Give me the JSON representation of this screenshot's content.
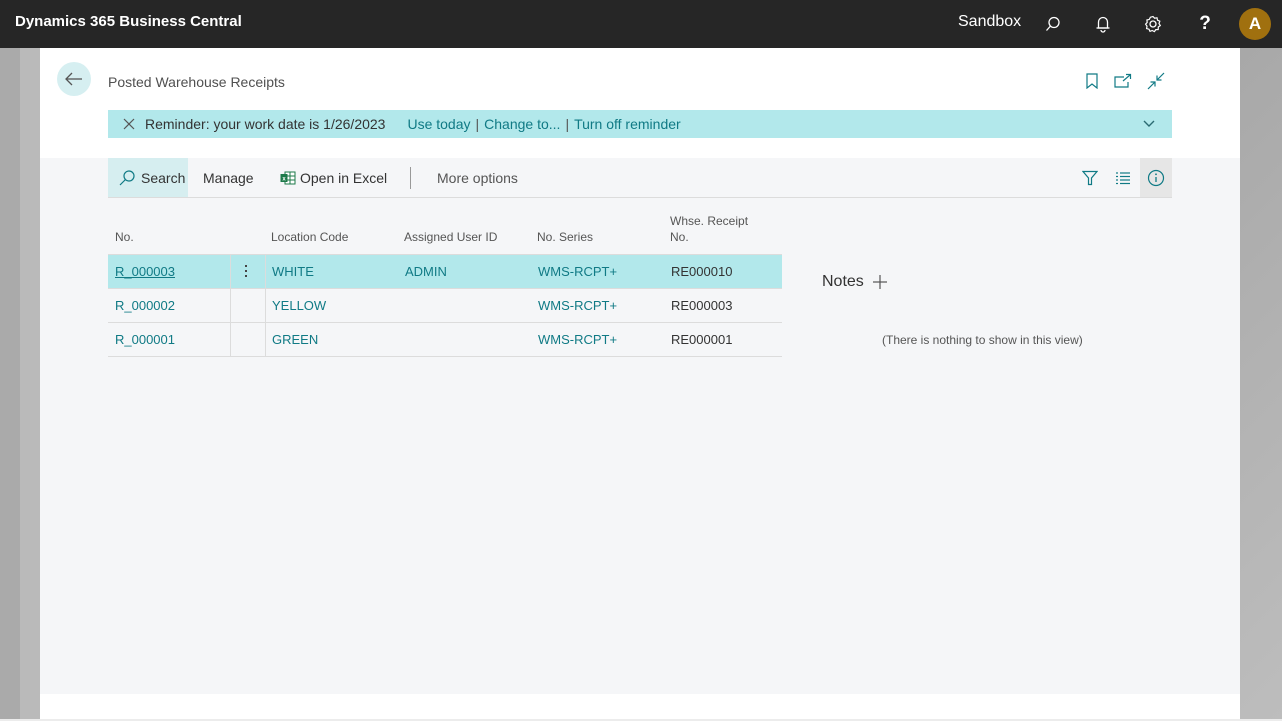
{
  "topbar": {
    "app_title": "Dynamics 365 Business Central",
    "environment": "Sandbox",
    "icons": [
      "search-icon",
      "bell-icon",
      "gear-icon",
      "help-icon"
    ],
    "help_glyph": "?",
    "avatar_initial": "A",
    "avatar_color": "#a0700f"
  },
  "page": {
    "title": "Posted Warehouse Receipts",
    "header_icons": [
      "bookmark-icon",
      "open-new-window-icon",
      "collapse-icon"
    ]
  },
  "reminder": {
    "message": "Reminder: your work date is 1/26/2023",
    "links": [
      "Use today",
      "Change to...",
      "Turn off reminder"
    ],
    "separator": "|",
    "background": "#b2e8eb"
  },
  "actionbar": {
    "search": "Search",
    "manage": "Manage",
    "open_in_excel": "Open in Excel",
    "more_options": "More options",
    "right_icons": [
      "filter-icon",
      "list-view-icon",
      "info-icon"
    ]
  },
  "grid": {
    "columns": {
      "no": "No.",
      "location_code": "Location Code",
      "assigned_user_id": "Assigned User ID",
      "no_series": "No. Series",
      "whse_receipt_no_line1": "Whse. Receipt",
      "whse_receipt_no_line2": "No."
    },
    "rows": [
      {
        "no": "R_000003",
        "location_code": "WHITE",
        "assigned_user_id": "ADMIN",
        "no_series": "WMS-RCPT+",
        "whse_receipt_no": "RE000010",
        "selected": true
      },
      {
        "no": "R_000002",
        "location_code": "YELLOW",
        "assigned_user_id": "",
        "no_series": "WMS-RCPT+",
        "whse_receipt_no": "RE000003",
        "selected": false
      },
      {
        "no": "R_000001",
        "location_code": "GREEN",
        "assigned_user_id": "",
        "no_series": "WMS-RCPT+",
        "whse_receipt_no": "RE000001",
        "selected": false
      }
    ]
  },
  "notes": {
    "title": "Notes",
    "empty_message": "(There is nothing to show in this view)"
  },
  "colors": {
    "accent": "#107a85",
    "topbar": "#262626",
    "selected_row": "#b2e8eb"
  }
}
